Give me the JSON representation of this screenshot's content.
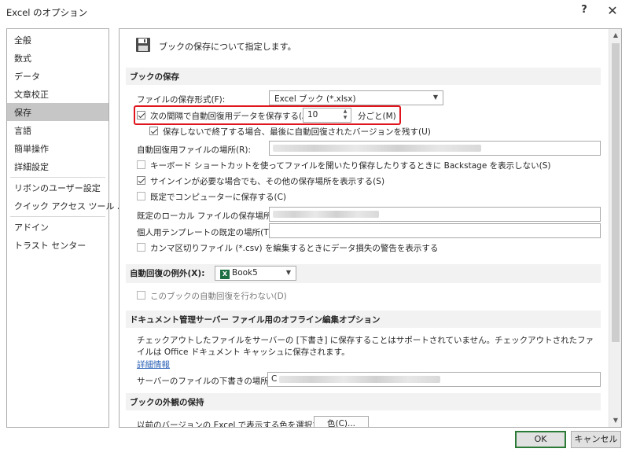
{
  "window": {
    "title": "Excel のオプション",
    "help": "?",
    "close": "✕"
  },
  "nav": {
    "items": [
      {
        "label": "全般"
      },
      {
        "label": "数式"
      },
      {
        "label": "データ"
      },
      {
        "label": "文章校正"
      },
      {
        "label": "保存",
        "selected": true
      },
      {
        "label": "言語"
      },
      {
        "label": "簡単操作"
      },
      {
        "label": "詳細設定"
      },
      {
        "label": "リボンのユーザー設定"
      },
      {
        "label": "クイック アクセス ツール バー"
      },
      {
        "label": "アドイン"
      },
      {
        "label": "トラスト センター"
      }
    ]
  },
  "page": {
    "header": "ブックの保存について指定します。"
  },
  "save_section": {
    "title": "ブックの保存",
    "format_label": "ファイルの保存形式(F):",
    "format_value": "Excel ブック (*.xlsx)",
    "autorecover_label": "次の間隔で自動回復用データを保存する(A):",
    "autorecover_checked": true,
    "autorecover_minutes": "10",
    "minutes_label": "分ごと(M)",
    "keep_last_label": "保存しないで終了する場合、最後に自動回復されたバージョンを残す(U)",
    "keep_last_checked": true,
    "autorecover_location_label": "自動回復用ファイルの場所(R):",
    "no_backstage_label": "キーボード ショートカットを使ってファイルを開いたり保存したりするときに Backstage を表示しない(S)",
    "no_backstage_checked": false,
    "show_additional_label": "サインインが必要な場合でも、その他の保存場所を表示する(S)",
    "show_additional_checked": true,
    "save_to_computer_label": "既定でコンピューターに保存する(C)",
    "save_to_computer_checked": false,
    "default_local_label": "既定のローカル ファイルの保存場所(I):",
    "template_location_label": "個人用テンプレートの既定の場所(T):",
    "template_location_value": "",
    "csv_warning_label": "カンマ区切りファイル (*.csv) を編集するときにデータ損失の警告を表示する",
    "csv_warning_checked": false
  },
  "exceptions_section": {
    "title": "自動回復の例外(X):",
    "workbook": "Book5",
    "workbook_icon": "X",
    "disable_autorecover_label": "このブックの自動回復を行わない(D)",
    "disable_autorecover_checked": false
  },
  "offline_section": {
    "title": "ドキュメント管理サーバー ファイル用のオフライン編集オプション",
    "description": "チェックアウトしたファイルをサーバーの [下書き] に保存することはサポートされていません。チェックアウトされたファイルは Office ドキュメント キャッシュに保存されます。",
    "details_link": "詳細情報",
    "drafts_location_label": "サーバーのファイルの下書きの場所(V):",
    "drafts_location_prefix": "C"
  },
  "appearance_section": {
    "title": "ブックの外観の保持",
    "colors_label": "以前のバージョンの Excel で表示する色を選択する:",
    "colors_button": "色(C)...",
    "info_icon": "i"
  },
  "buttons": {
    "ok": "OK",
    "cancel": "キャンセル"
  },
  "icons": {
    "save": "floppy-disk-icon",
    "dropdown": "▼",
    "spin_up": "▲",
    "spin_down": "▼",
    "scroll_up": "▲",
    "scroll_down": "▼"
  },
  "colors": {
    "highlight_border": "#e0141c",
    "selected_nav": "#c6c6c6",
    "ok_border": "#2b7a35",
    "link": "#2e63b8"
  }
}
